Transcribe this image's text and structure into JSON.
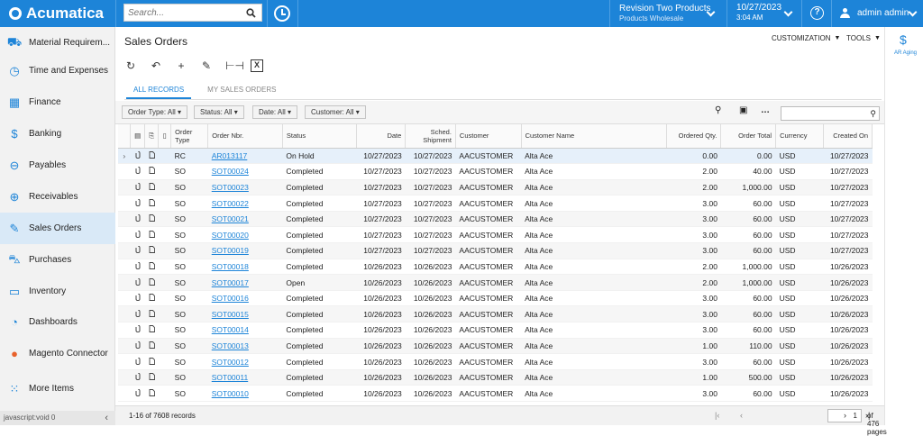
{
  "app": {
    "title": "Acumatica"
  },
  "search": {
    "placeholder": "Search..."
  },
  "company": {
    "name": "Revision Two Products",
    "branch": "Products Wholesale"
  },
  "datetime": {
    "date": "10/27/2023",
    "time": "3:04 AM"
  },
  "user": {
    "name": "admin admin"
  },
  "sidebar": {
    "items": [
      {
        "label": "Material Requirem...",
        "icon": "material-icon"
      },
      {
        "label": "Time and Expenses",
        "icon": "clock-icon"
      },
      {
        "label": "Finance",
        "icon": "calculator-icon"
      },
      {
        "label": "Banking",
        "icon": "dollar-icon"
      },
      {
        "label": "Payables",
        "icon": "minus-circle-icon"
      },
      {
        "label": "Receivables",
        "icon": "plus-circle-icon"
      },
      {
        "label": "Sales Orders",
        "icon": "pencil-icon"
      },
      {
        "label": "Purchases",
        "icon": "cart-icon"
      },
      {
        "label": "Inventory",
        "icon": "truck-icon"
      },
      {
        "label": "Dashboards",
        "icon": "gauge-icon"
      },
      {
        "label": "Magento Connector",
        "icon": "magento-icon"
      },
      {
        "label": "More Items",
        "icon": "grid-icon"
      }
    ],
    "status": "javascript:void 0"
  },
  "page": {
    "title": "Sales Orders",
    "customization": "CUSTOMIZATION",
    "tools": "TOOLS"
  },
  "tabs": [
    "ALL RECORDS",
    "MY SALES ORDERS"
  ],
  "filters": [
    "Order Type: All",
    "Status: All",
    "Date: All",
    "Customer: All"
  ],
  "columns": [
    "Order Type",
    "Order Nbr.",
    "Status",
    "Date",
    "Sched. Shipment",
    "Customer",
    "Customer Name",
    "Ordered Qty.",
    "Order Total",
    "Currency",
    "Created On"
  ],
  "rows": [
    {
      "type": "RC",
      "nbr": "AR013117",
      "status": "On Hold",
      "date": "10/27/2023",
      "sched": "10/27/2023",
      "customer": "AACUSTOMER",
      "name": "Alta Ace",
      "qty": "0.00",
      "total": "0.00",
      "currency": "USD",
      "created": "10/27/2023"
    },
    {
      "type": "SO",
      "nbr": "SOT00024",
      "status": "Completed",
      "date": "10/27/2023",
      "sched": "10/27/2023",
      "customer": "AACUSTOMER",
      "name": "Alta Ace",
      "qty": "2.00",
      "total": "40.00",
      "currency": "USD",
      "created": "10/27/2023"
    },
    {
      "type": "SO",
      "nbr": "SOT00023",
      "status": "Completed",
      "date": "10/27/2023",
      "sched": "10/27/2023",
      "customer": "AACUSTOMER",
      "name": "Alta Ace",
      "qty": "2.00",
      "total": "1,000.00",
      "currency": "USD",
      "created": "10/27/2023"
    },
    {
      "type": "SO",
      "nbr": "SOT00022",
      "status": "Completed",
      "date": "10/27/2023",
      "sched": "10/27/2023",
      "customer": "AACUSTOMER",
      "name": "Alta Ace",
      "qty": "3.00",
      "total": "60.00",
      "currency": "USD",
      "created": "10/27/2023"
    },
    {
      "type": "SO",
      "nbr": "SOT00021",
      "status": "Completed",
      "date": "10/27/2023",
      "sched": "10/27/2023",
      "customer": "AACUSTOMER",
      "name": "Alta Ace",
      "qty": "3.00",
      "total": "60.00",
      "currency": "USD",
      "created": "10/27/2023"
    },
    {
      "type": "SO",
      "nbr": "SOT00020",
      "status": "Completed",
      "date": "10/27/2023",
      "sched": "10/27/2023",
      "customer": "AACUSTOMER",
      "name": "Alta Ace",
      "qty": "3.00",
      "total": "60.00",
      "currency": "USD",
      "created": "10/27/2023"
    },
    {
      "type": "SO",
      "nbr": "SOT00019",
      "status": "Completed",
      "date": "10/27/2023",
      "sched": "10/27/2023",
      "customer": "AACUSTOMER",
      "name": "Alta Ace",
      "qty": "3.00",
      "total": "60.00",
      "currency": "USD",
      "created": "10/27/2023"
    },
    {
      "type": "SO",
      "nbr": "SOT00018",
      "status": "Completed",
      "date": "10/26/2023",
      "sched": "10/26/2023",
      "customer": "AACUSTOMER",
      "name": "Alta Ace",
      "qty": "2.00",
      "total": "1,000.00",
      "currency": "USD",
      "created": "10/26/2023"
    },
    {
      "type": "SO",
      "nbr": "SOT00017",
      "status": "Open",
      "date": "10/26/2023",
      "sched": "10/26/2023",
      "customer": "AACUSTOMER",
      "name": "Alta Ace",
      "qty": "2.00",
      "total": "1,000.00",
      "currency": "USD",
      "created": "10/26/2023"
    },
    {
      "type": "SO",
      "nbr": "SOT00016",
      "status": "Completed",
      "date": "10/26/2023",
      "sched": "10/26/2023",
      "customer": "AACUSTOMER",
      "name": "Alta Ace",
      "qty": "3.00",
      "total": "60.00",
      "currency": "USD",
      "created": "10/26/2023"
    },
    {
      "type": "SO",
      "nbr": "SOT00015",
      "status": "Completed",
      "date": "10/26/2023",
      "sched": "10/26/2023",
      "customer": "AACUSTOMER",
      "name": "Alta Ace",
      "qty": "3.00",
      "total": "60.00",
      "currency": "USD",
      "created": "10/26/2023"
    },
    {
      "type": "SO",
      "nbr": "SOT00014",
      "status": "Completed",
      "date": "10/26/2023",
      "sched": "10/26/2023",
      "customer": "AACUSTOMER",
      "name": "Alta Ace",
      "qty": "3.00",
      "total": "60.00",
      "currency": "USD",
      "created": "10/26/2023"
    },
    {
      "type": "SO",
      "nbr": "SOT00013",
      "status": "Completed",
      "date": "10/26/2023",
      "sched": "10/26/2023",
      "customer": "AACUSTOMER",
      "name": "Alta Ace",
      "qty": "1.00",
      "total": "110.00",
      "currency": "USD",
      "created": "10/26/2023"
    },
    {
      "type": "SO",
      "nbr": "SOT00012",
      "status": "Completed",
      "date": "10/26/2023",
      "sched": "10/26/2023",
      "customer": "AACUSTOMER",
      "name": "Alta Ace",
      "qty": "3.00",
      "total": "60.00",
      "currency": "USD",
      "created": "10/26/2023"
    },
    {
      "type": "SO",
      "nbr": "SOT00011",
      "status": "Completed",
      "date": "10/26/2023",
      "sched": "10/26/2023",
      "customer": "AACUSTOMER",
      "name": "Alta Ace",
      "qty": "1.00",
      "total": "500.00",
      "currency": "USD",
      "created": "10/26/2023"
    },
    {
      "type": "SO",
      "nbr": "SOT00010",
      "status": "Completed",
      "date": "10/26/2023",
      "sched": "10/26/2023",
      "customer": "AACUSTOMER",
      "name": "Alta Ace",
      "qty": "3.00",
      "total": "60.00",
      "currency": "USD",
      "created": "10/26/2023"
    }
  ],
  "pager": {
    "count": "1-16 of 7608 records",
    "page": "1",
    "of": "of 476 pages"
  },
  "rightpanel": {
    "label": "AR Aging"
  },
  "colors": {
    "accent": "#1d84d8",
    "sidebar_active": "#d9e9f7"
  }
}
